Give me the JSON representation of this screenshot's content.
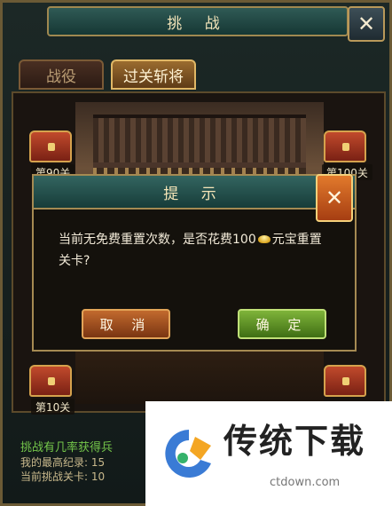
{
  "header": {
    "title": "挑 战",
    "close_icon": "close-icon"
  },
  "tabs": [
    {
      "label": "战役",
      "active": false
    },
    {
      "label": "过关斩将",
      "active": true
    }
  ],
  "stages": [
    {
      "label": "第90关",
      "side": "left"
    },
    {
      "label": "第100关",
      "side": "right"
    },
    {
      "label": "第10关",
      "side": "left"
    }
  ],
  "dialog": {
    "title": "提 示",
    "message_pre": "当前无免费重置次数，是否花费100",
    "message_post": "元宝重置关卡?",
    "cancel_label": "取 消",
    "confirm_label": "确 定"
  },
  "info": {
    "hint": "挑战有几率获得兵",
    "best_record": "我的最高纪录: 15",
    "current_stage": "当前挑战关卡: 10"
  },
  "watermark": {
    "name": "传统下载",
    "url": "ctdown.com"
  },
  "colors": {
    "accent_gold": "#a58a52",
    "teal": "#336560",
    "confirm_green": "#7fb43a",
    "cancel_orange": "#c26a2e"
  }
}
